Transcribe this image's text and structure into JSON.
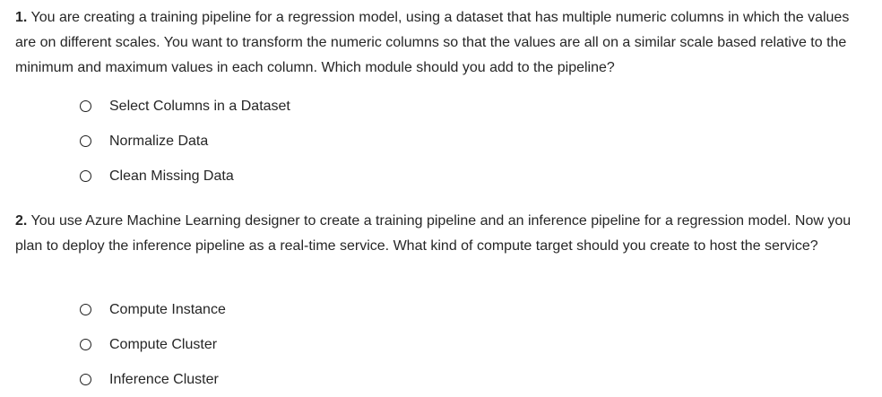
{
  "questions": [
    {
      "number": "1.",
      "text": "You are creating a training pipeline for a regression model, using a dataset that has multiple numeric columns in which the values are on different scales. You want to transform the numeric columns so that the values are all on a similar scale based relative to the minimum and maximum values in each column. Which module should you add to the pipeline?",
      "options": [
        "Select Columns in a Dataset",
        "Normalize Data",
        "Clean Missing Data"
      ]
    },
    {
      "number": "2.",
      "text": "You use Azure Machine Learning designer to create a training pipeline and an inference pipeline for a regression model. Now you plan to deploy the inference pipeline as a real-time service. What kind of compute target should you create to host the service?",
      "options": [
        "Compute Instance",
        "Compute Cluster",
        "Inference Cluster"
      ]
    }
  ]
}
